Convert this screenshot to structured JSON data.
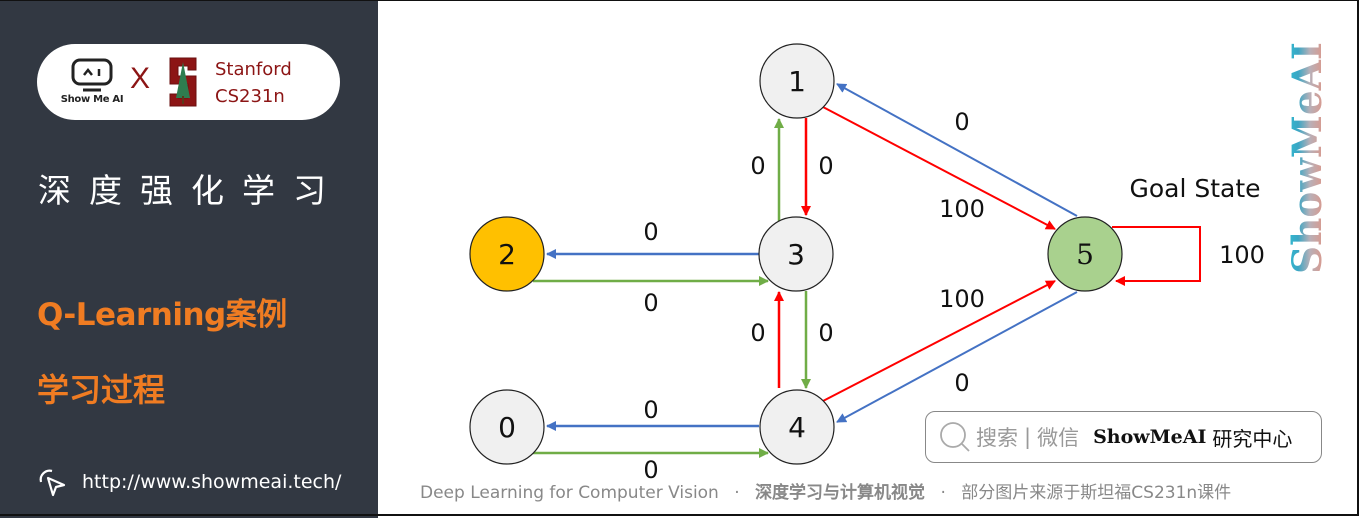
{
  "sidebar": {
    "logo": {
      "showmeai_text": "Show Me AI",
      "cross": "X",
      "stanford_line1": "Stanford",
      "stanford_line2": "CS231n"
    },
    "title": "深度强化学习",
    "subtitle1": "Q-Learning案例",
    "subtitle2": "学习过程",
    "url": "http://www.showmeai.tech/",
    "colors": {
      "background": "#323842",
      "accent": "#f07c22",
      "stanford": "#8c1515"
    }
  },
  "diagram": {
    "goal_label": "Goal State",
    "nodes": [
      {
        "id": "0",
        "label": "0",
        "fill": "#f0f0f0"
      },
      {
        "id": "1",
        "label": "1",
        "fill": "#f0f0f0"
      },
      {
        "id": "2",
        "label": "2",
        "fill": "#ffc000"
      },
      {
        "id": "3",
        "label": "3",
        "fill": "#f0f0f0"
      },
      {
        "id": "4",
        "label": "4",
        "fill": "#f0f0f0"
      },
      {
        "id": "5",
        "label": "5",
        "fill": "#a9d18e"
      }
    ],
    "edges": [
      {
        "from": "3",
        "to": "2",
        "reward": "0",
        "color": "#4472c4"
      },
      {
        "from": "2",
        "to": "3",
        "reward": "0",
        "color": "#70ad47"
      },
      {
        "from": "3",
        "to": "1",
        "reward": "0",
        "color": "#70ad47"
      },
      {
        "from": "1",
        "to": "3",
        "reward": "0",
        "color": "#ff0000"
      },
      {
        "from": "4",
        "to": "3",
        "reward": "0",
        "color": "#ff0000"
      },
      {
        "from": "3",
        "to": "4",
        "reward": "0",
        "color": "#70ad47"
      },
      {
        "from": "4",
        "to": "0",
        "reward": "0",
        "color": "#4472c4"
      },
      {
        "from": "0",
        "to": "4",
        "reward": "0",
        "color": "#70ad47"
      },
      {
        "from": "5",
        "to": "1",
        "reward": "0",
        "color": "#4472c4"
      },
      {
        "from": "1",
        "to": "5",
        "reward": "100",
        "color": "#ff0000"
      },
      {
        "from": "4",
        "to": "5",
        "reward": "100",
        "color": "#ff0000"
      },
      {
        "from": "5",
        "to": "4",
        "reward": "0",
        "color": "#4472c4"
      },
      {
        "from": "5",
        "to": "5",
        "reward": "100",
        "color": "#ff0000"
      }
    ]
  },
  "watermark": "ShowMeAI",
  "search_box": {
    "icon": "search-icon",
    "label": "搜索",
    "divider": "|",
    "channel": "微信",
    "brand": "ShowMeAI",
    "brand_suffix": "研究中心"
  },
  "footer": {
    "part1": "Deep Learning for Computer Vision",
    "sep": "·",
    "part2": "深度学习与计算机视觉",
    "part3": "部分图片来源于斯坦福CS231n课件"
  }
}
